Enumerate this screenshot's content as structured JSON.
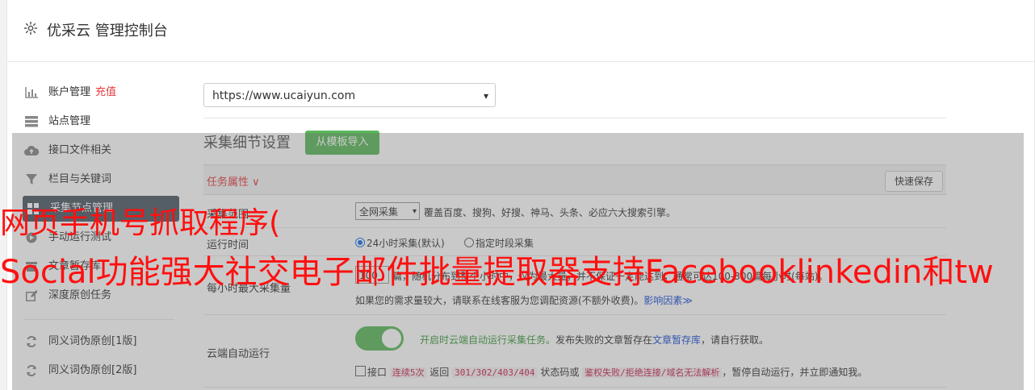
{
  "header": {
    "title": "优采云 管理控制台"
  },
  "sidebar": {
    "items": [
      {
        "label": "账户管理",
        "extra": "充值"
      },
      {
        "label": "站点管理"
      },
      {
        "label": "接口文件相关"
      },
      {
        "label": "栏目与关键词"
      },
      {
        "label": "采集节点管理"
      },
      {
        "label": "手动运行测试"
      },
      {
        "label": "文章暂存库"
      },
      {
        "label": "深度原创任务"
      },
      {
        "label": "同义词伪原创[1版]"
      },
      {
        "label": "同义词伪原创[2版]"
      }
    ]
  },
  "main": {
    "site_select": "https://www.ucaiyun.com",
    "section_title": "采集细节设置",
    "import_button": "从模板导入",
    "task_props": "任务属性 ∨",
    "quick_save": "快速保存",
    "scope": {
      "label": "采集范围",
      "value": "全网采集",
      "desc": "覆盖百度、搜狗、好搜、神马、头条、必应六大搜索引擎。"
    },
    "runtime": {
      "label": "运行时间",
      "opt1": "24小时采集(默认)",
      "opt2": "指定时段采集"
    },
    "max_per_hour": {
      "label": "每小时最大采集量",
      "value": "100",
      "desc": "篇，随机分布到整个小时中，仅为最大量，并不保证一定能达到，通常可达100-300篇每小时(每站)。",
      "note": "如果您的需求量较大，请联系在线客服为您调配资源(不额外收费)。",
      "factor_link": "影响因素≫"
    },
    "cloud_run": {
      "label": "云端自动运行",
      "on_text": "开启时云端自动运行采集任务。",
      "text2": "发布失败的文章暂存在",
      "link": "文章暂存库",
      "text3": "，请自行获取。",
      "chk_label": "接口",
      "code1": "连续5次",
      "t_back": "返回",
      "code2": "301/302/403/404",
      "t_status": "状态码或",
      "code3": "鉴权失败/拒绝连接/域名无法解析",
      "t_tail": "，暂停自动运行，并立即通知我。"
    }
  },
  "watermark": {
    "line1": "网页手机号抓取程序(",
    "line2": "Social功能强大社交电子邮件批量提取器支持Facebooklinkedin和tw"
  },
  "colors": {
    "green": "#5cb85c",
    "red": "#e4393c",
    "sidebar_active": "#4e5a66"
  }
}
